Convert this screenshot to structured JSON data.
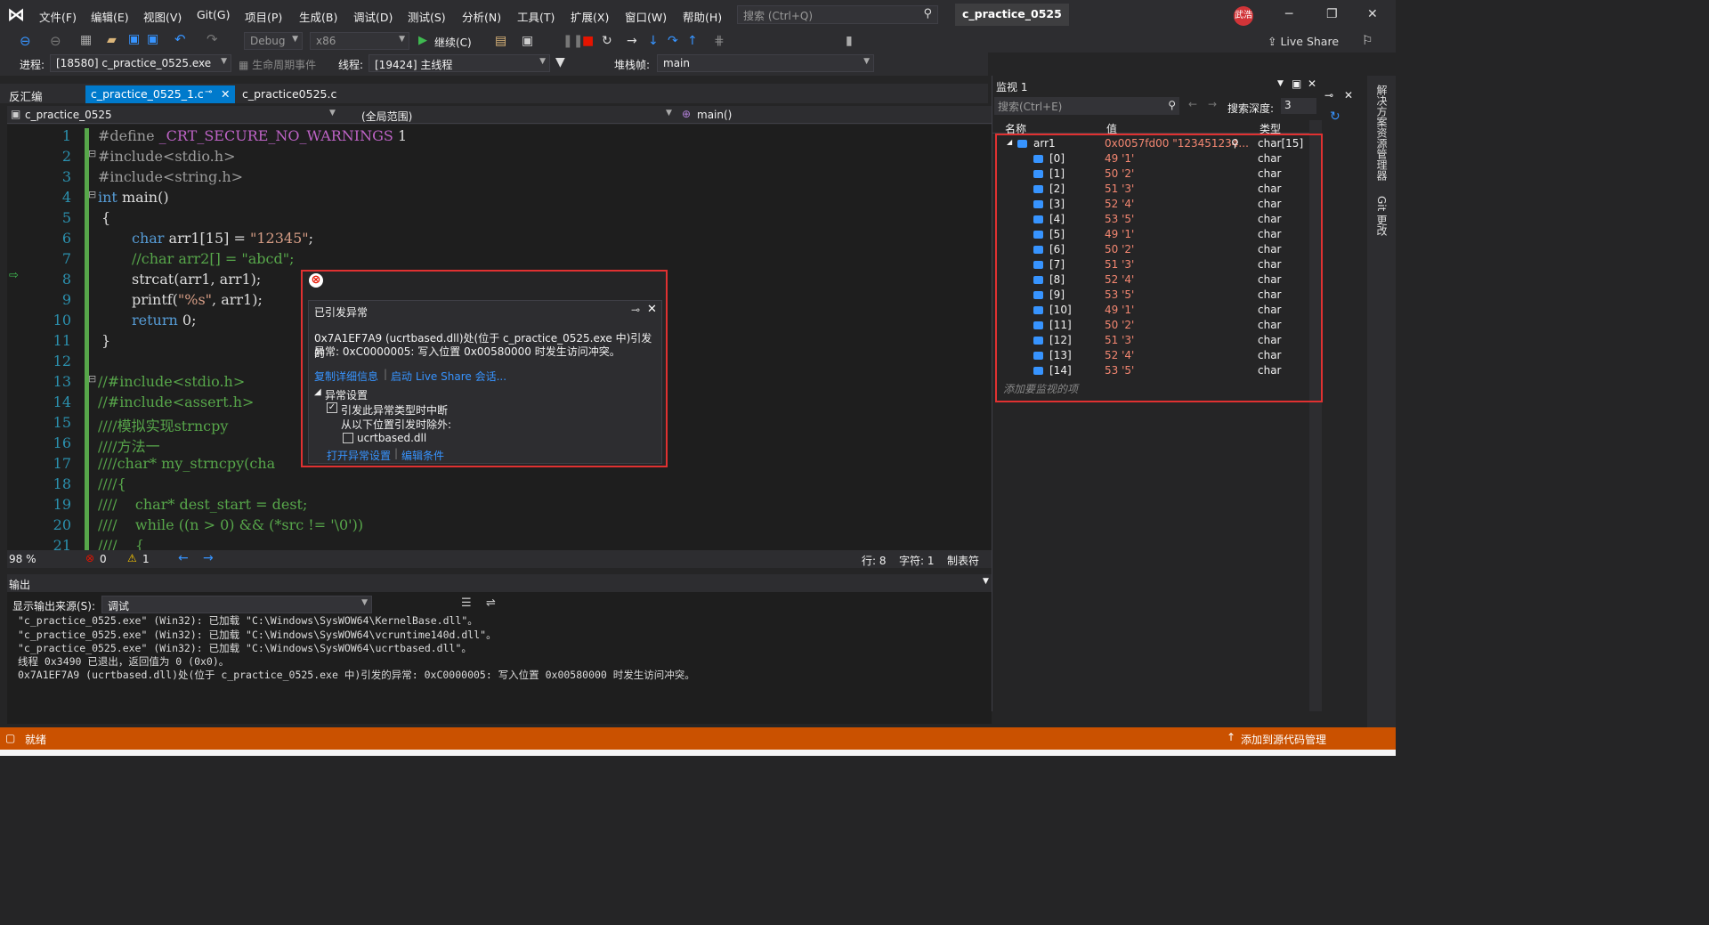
{
  "menu": {
    "items": [
      "文件(F)",
      "编辑(E)",
      "视图(V)",
      "Git(G)",
      "项目(P)",
      "生成(B)",
      "调试(D)",
      "测试(S)",
      "分析(N)",
      "工具(T)",
      "扩展(X)",
      "窗口(W)",
      "帮助(H)"
    ],
    "search_placeholder": "搜索 (Ctrl+Q)",
    "solution_title": "c_practice_0525",
    "avatar": "武浩",
    "live_share": "Live Share"
  },
  "toolbar": {
    "config": "Debug",
    "platform": "x86",
    "continue": "继续(C)"
  },
  "toolbar2": {
    "process_label": "进程:",
    "process_value": "[18580] c_practice_0525.exe",
    "lifecycle": "生命周期事件",
    "thread_label": "线程:",
    "thread_value": "[19424] 主线程",
    "stack_label": "堆栈帧:",
    "stack_value": "main"
  },
  "tabs": {
    "disasm": "反汇编",
    "file1": "c_practice_0525_1.c",
    "file2": "c_practice0525.c"
  },
  "nav": {
    "project": "c_practice_0525",
    "scope": "(全局范围)",
    "func": "main()"
  },
  "code_lines": [
    {
      "n": "1"
    },
    {
      "n": "2"
    },
    {
      "n": "3"
    },
    {
      "n": "4"
    },
    {
      "n": "5"
    },
    {
      "n": "6"
    },
    {
      "n": "7"
    },
    {
      "n": "8"
    },
    {
      "n": "9"
    },
    {
      "n": "10"
    },
    {
      "n": "11"
    },
    {
      "n": "12"
    },
    {
      "n": "13"
    },
    {
      "n": "14"
    },
    {
      "n": "15"
    },
    {
      "n": "16"
    },
    {
      "n": "17"
    },
    {
      "n": "18"
    },
    {
      "n": "19"
    },
    {
      "n": "20"
    },
    {
      "n": "21"
    }
  ],
  "code": {
    "l1a": "#define ",
    "l1b": "_CRT_SECURE_NO_WARNINGS",
    " l1c": " 1",
    "l2": "#include<stdio.h>",
    "l3": "#include<string.h>",
    "l4a": "int",
    "l4b": " main()",
    "l5": "{",
    "l6a": "char",
    "l6b": " arr1[15] = ",
    "l6c": "\"12345\"",
    "l6d": ";",
    "l7": "//char arr2[] = \"abcd\";",
    "l8": "strcat(arr1, arr1);",
    "l9a": "printf(",
    "l9b": "\"%s\"",
    "l9c": ", arr1);",
    "l10a": "return",
    "l10b": " 0;",
    "l11": "}",
    "l13": "//#include<stdio.h>",
    "l14": "//#include<assert.h>",
    "l15": "////模拟实现strncpy",
    "l16": "////方法一",
    "l17": "////char* my_strncpy(cha",
    "l18": "////{",
    "l19": "////    char* dest_start = dest;",
    "l20": "////    while ((n > 0) && (*src != '\\0'))",
    "l21": "////    {"
  },
  "status1": {
    "zoom": "98 %",
    "errors": "0",
    "warnings": "1",
    "line": "行: 8",
    "col": "字符: 1",
    "tabs": "制表符"
  },
  "popup": {
    "title": "已引发异常",
    "msg1": "0x7A1EF7A9 (ucrtbased.dll)处(位于 c_practice_0525.exe 中)引发的",
    "msg2": "异常: 0xC0000005: 写入位置 0x00580000 时发生访问冲突。",
    "copy": "复制详细信息",
    "live": "启动 Live Share 会话...",
    "section": "异常设置",
    "check1": "引发此异常类型时中断",
    "except": "从以下位置引发时除外:",
    "check2": "ucrtbased.dll",
    "open": "打开异常设置",
    "edit": "编辑条件"
  },
  "output": {
    "title": "输出",
    "source_label": "显示输出来源(S):",
    "source": "调试",
    "lines": [
      "\"c_practice_0525.exe\" (Win32): 已加载 \"C:\\Windows\\SysWOW64\\KernelBase.dll\"。",
      "\"c_practice_0525.exe\" (Win32): 已加载 \"C:\\Windows\\SysWOW64\\vcruntime140d.dll\"。",
      "\"c_practice_0525.exe\" (Win32): 已加载 \"C:\\Windows\\SysWOW64\\ucrtbased.dll\"。",
      "线程 0x3490 已退出，返回值为 0 (0x0)。",
      "0x7A1EF7A9 (ucrtbased.dll)处(位于 c_practice_0525.exe 中)引发的异常: 0xC0000005: 写入位置 0x00580000 时发生访问冲突。"
    ]
  },
  "watch": {
    "title": "监视 1",
    "search": "搜索(Ctrl+E)",
    "depth_label": "搜索深度:",
    "depth": "3",
    "col_name": "名称",
    "col_value": "值",
    "col_type": "类型",
    "root": {
      "name": "arr1",
      "value": "0x0057fd00 \"123451234...",
      "type": "char[15]"
    },
    "rows": [
      {
        "name": "[0]",
        "value": "49 '1'",
        "type": "char"
      },
      {
        "name": "[1]",
        "value": "50 '2'",
        "type": "char"
      },
      {
        "name": "[2]",
        "value": "51 '3'",
        "type": "char"
      },
      {
        "name": "[3]",
        "value": "52 '4'",
        "type": "char"
      },
      {
        "name": "[4]",
        "value": "53 '5'",
        "type": "char"
      },
      {
        "name": "[5]",
        "value": "49 '1'",
        "type": "char"
      },
      {
        "name": "[6]",
        "value": "50 '2'",
        "type": "char"
      },
      {
        "name": "[7]",
        "value": "51 '3'",
        "type": "char"
      },
      {
        "name": "[8]",
        "value": "52 '4'",
        "type": "char"
      },
      {
        "name": "[9]",
        "value": "53 '5'",
        "type": "char"
      },
      {
        "name": "[10]",
        "value": "49 '1'",
        "type": "char"
      },
      {
        "name": "[11]",
        "value": "50 '2'",
        "type": "char"
      },
      {
        "name": "[12]",
        "value": "51 '3'",
        "type": "char"
      },
      {
        "name": "[13]",
        "value": "52 '4'",
        "type": "char"
      },
      {
        "name": "[14]",
        "value": "53 '5'",
        "type": "char"
      }
    ],
    "add": "添加要监视的项"
  },
  "side": {
    "a": "解决方案资源管理器",
    "b": "Git 更改"
  },
  "statusbar": {
    "ready": "就绪",
    "source_ctrl": "添加到源代码管理"
  }
}
